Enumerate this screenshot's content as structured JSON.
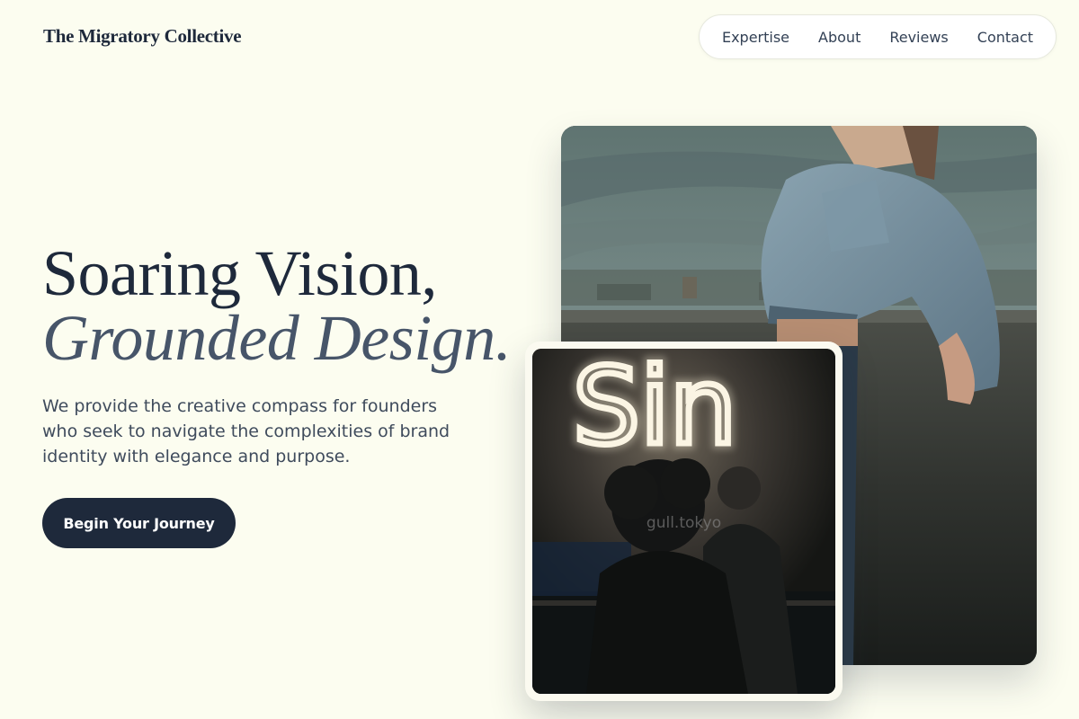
{
  "header": {
    "brand": "The Migratory Collective",
    "nav": [
      {
        "label": "Expertise"
      },
      {
        "label": "About"
      },
      {
        "label": "Reviews"
      },
      {
        "label": "Contact"
      }
    ]
  },
  "hero": {
    "headline_line1": "Soaring Vision,",
    "headline_line2": "Grounded Design.",
    "lede": "We provide the creative compass for founders who seek to navigate the complexities of brand identity with elegance and purpose.",
    "cta_label": "Begin Your Journey"
  },
  "images": {
    "back_alt": "Person in denim jacket leaning on a rooftop wall at dusk",
    "front_alt": "Silhouette of a person in front of a neon 'Sin' sign",
    "front_neon_text": "Sin",
    "front_watermark": "gull.tokyo"
  },
  "colors": {
    "background": "#fcfdf0",
    "primary": "#1e293b",
    "secondary_text": "#475569"
  }
}
